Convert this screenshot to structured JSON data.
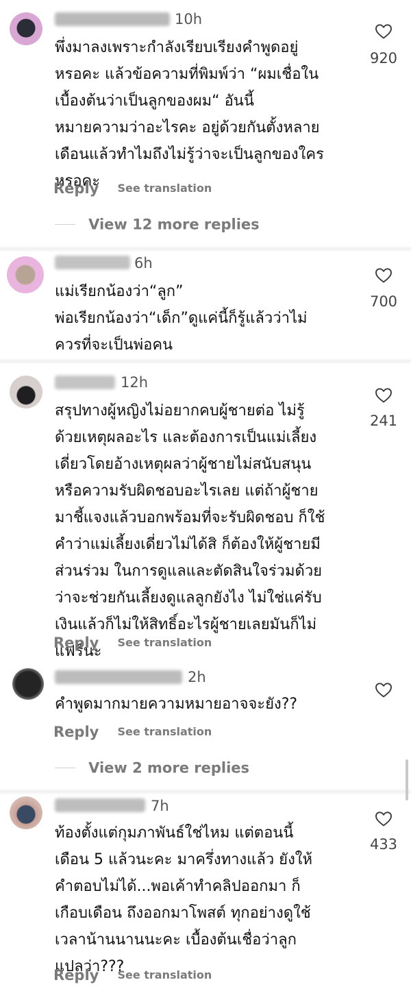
{
  "comments": [
    {
      "time": "10h",
      "text": "พึ่งมาลงเพราะกำลังเรียบเรียงคำพูดอยู่\nหรอคะ แล้วข้อความที่พิมพ์ว่า “ผมเชื่อใน\nเบื้องต้นว่าเป็นลูกของผม“ อันนี้\nหมายความว่าอะไรคะ อยู่ด้วยกันตั้งหลาย\nเดือนแล้วทำไมถึงไม่รู้ว่าจะเป็นลูกของใคร\nหรอคะ",
      "likes": "920",
      "reply_label": "Reply",
      "translate_label": "See translation",
      "view_more": "View 12 more replies"
    },
    {
      "time": "6h",
      "text": "แม่เรียกน้องว่า“ลูก”\nพ่อเรียกน้องว่า“เด็ก”ดูแค่นี้ก็รู้แล้วว่าไม่\nควรที่จะเป็นพ่อคน",
      "likes": "700"
    },
    {
      "time": "12h",
      "text": "สรุปทางผู้หญิงไม่อยากคบผู้ชายต่อ ไม่รู้\nด้วยเหตุผลอะไร และต้องการเป็นแม่เลี้ยง\nเดี่ยวโดยอ้างเหตุผลว่าผู้ชายไม่สนับสนุน\nหรือความรับผิดชอบอะไรเลย แต่ถ้าผู้ชาย\nมาชี้แจงแล้วบอกพร้อมที่จะรับผิดชอบ ก็ใช้\nคำว่าแม่เลี้ยงเดี่ยวไม่ได้สิ ก็ต้องให้ผู้ชายมี\nส่วนร่วม ในการดูแลและตัดสินใจร่วมด้วย\nว่าจะช่วยกันเลี้ยงดูแลลูกยังไง ไม่ใช่แค่รับ\nเงินแล้วก็ไม่ให้สิทธิ์อะไรผู้ชายเลยมันก็ไม่\nแฟร์นะ",
      "likes": "241",
      "reply_label": "Reply",
      "translate_label": "See translation"
    },
    {
      "time": "2h",
      "text": "คำพูดมากมายความหมายอาจจะยัง??",
      "reply_label": "Reply",
      "translate_label": "See translation",
      "view_more": "View 2 more replies"
    },
    {
      "time": "7h",
      "text": "ท้องตั้งแต่กุมภาพันธ์ใช่ไหม แต่ตอนนี้\nเดือน 5 แล้วนะคะ มาครึ่งทางแล้ว ยังให้\nคำตอบไม่ได้...พอเค้าทำคลิปออกมา ก็\nเกือบเดือน ถึงออกมาโพสต์ ทุกอย่างดูใช้\nเวลาน้านนานนะคะ เบื้องต้นเชื่อว่าลูก\nแปลว่า???",
      "likes": "433",
      "reply_label": "Reply",
      "translate_label": "See translation"
    }
  ],
  "colors": {
    "text": "#111111",
    "secondary": "#7a7a7a",
    "likes": "#444444"
  },
  "icons": {
    "like": "heart-outline-icon"
  }
}
